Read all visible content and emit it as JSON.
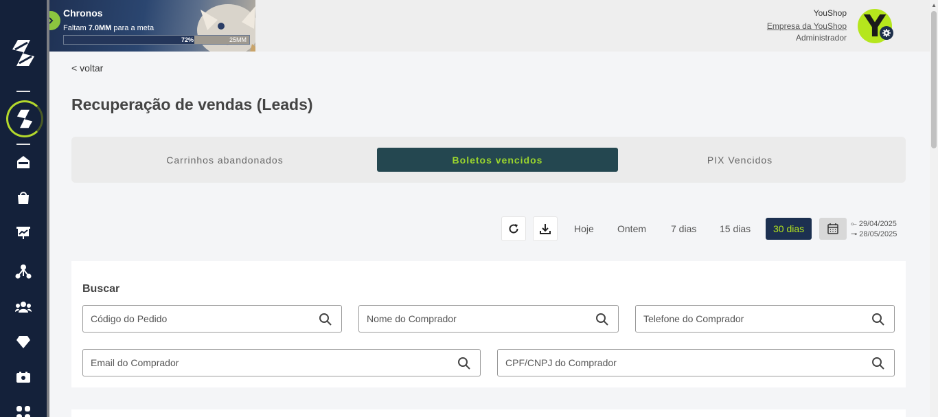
{
  "banner": {
    "title": "Chronos",
    "subtitle_prefix": "Faltam ",
    "subtitle_amount": "7.0MM",
    "subtitle_suffix": " para a meta",
    "progress_percent": 72,
    "progress_label": "72%",
    "goal_label": "25MM"
  },
  "user": {
    "name": "YouShop",
    "company": "Empresa da YouShop",
    "role": "Administrador",
    "avatar_letter": "Y"
  },
  "nav": {
    "back_label": "< voltar"
  },
  "page": {
    "title": "Recuperação de vendas (Leads)"
  },
  "tabs": [
    {
      "label": "Carrinhos abandonados",
      "active": false
    },
    {
      "label": "Boletos vencidos",
      "active": true
    },
    {
      "label": "PIX Vencidos",
      "active": false
    }
  ],
  "toolbar": {
    "refresh_icon": "refresh-icon",
    "download_icon": "download-icon",
    "ranges": [
      {
        "label": "Hoje",
        "active": false
      },
      {
        "label": "Ontem",
        "active": false
      },
      {
        "label": "7 dias",
        "active": false
      },
      {
        "label": "15 dias",
        "active": false
      },
      {
        "label": "30 dias",
        "active": true
      }
    ],
    "date_start": "29/04/2025",
    "date_end": "28/05/2025"
  },
  "search": {
    "title": "Buscar",
    "fields": [
      {
        "placeholder": "Código do Pedido",
        "value": ""
      },
      {
        "placeholder": "Nome do Comprador",
        "value": ""
      },
      {
        "placeholder": "Telefone do Comprador",
        "value": ""
      },
      {
        "placeholder": "Email do Comprador",
        "value": ""
      },
      {
        "placeholder": "CPF/CNPJ do Comprador",
        "value": ""
      }
    ]
  },
  "colors": {
    "sidebar": "#14213a",
    "accent_green": "#b5e61d",
    "active_tab": "#244750",
    "active_range": "#1c3050"
  }
}
